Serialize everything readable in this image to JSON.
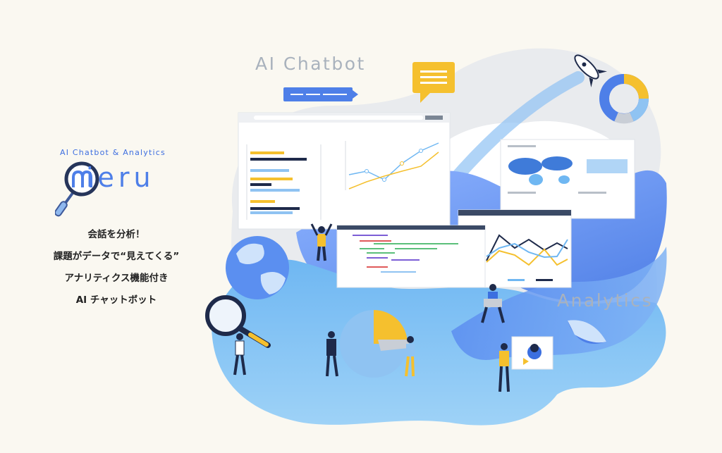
{
  "brand": {
    "tagline": "AI Chatbot & Analytics",
    "logo_text": "ieru",
    "logo_lettering": "mieru"
  },
  "copy": {
    "lines": [
      "会話を分析！",
      "課題がデータで“見えてくる”",
      "アナリティクス機能付き",
      "AI チャットボット"
    ]
  },
  "illustration": {
    "label_chatbot": "AI Chatbot",
    "label_analytics": "Analytics"
  },
  "colors": {
    "background": "#faf8f1",
    "brand_blue": "#4e7fe8",
    "accent_yellow": "#f5c02e",
    "wave_blue": "#5b8ff0",
    "wave_light": "#8fc3f2",
    "navy": "#1e2a4a",
    "label_gray": "#a9b2bd"
  },
  "icons": [
    "magnifier-icon",
    "rocket-icon",
    "globe-icon",
    "speech-bubble-icon",
    "donut-icon"
  ]
}
